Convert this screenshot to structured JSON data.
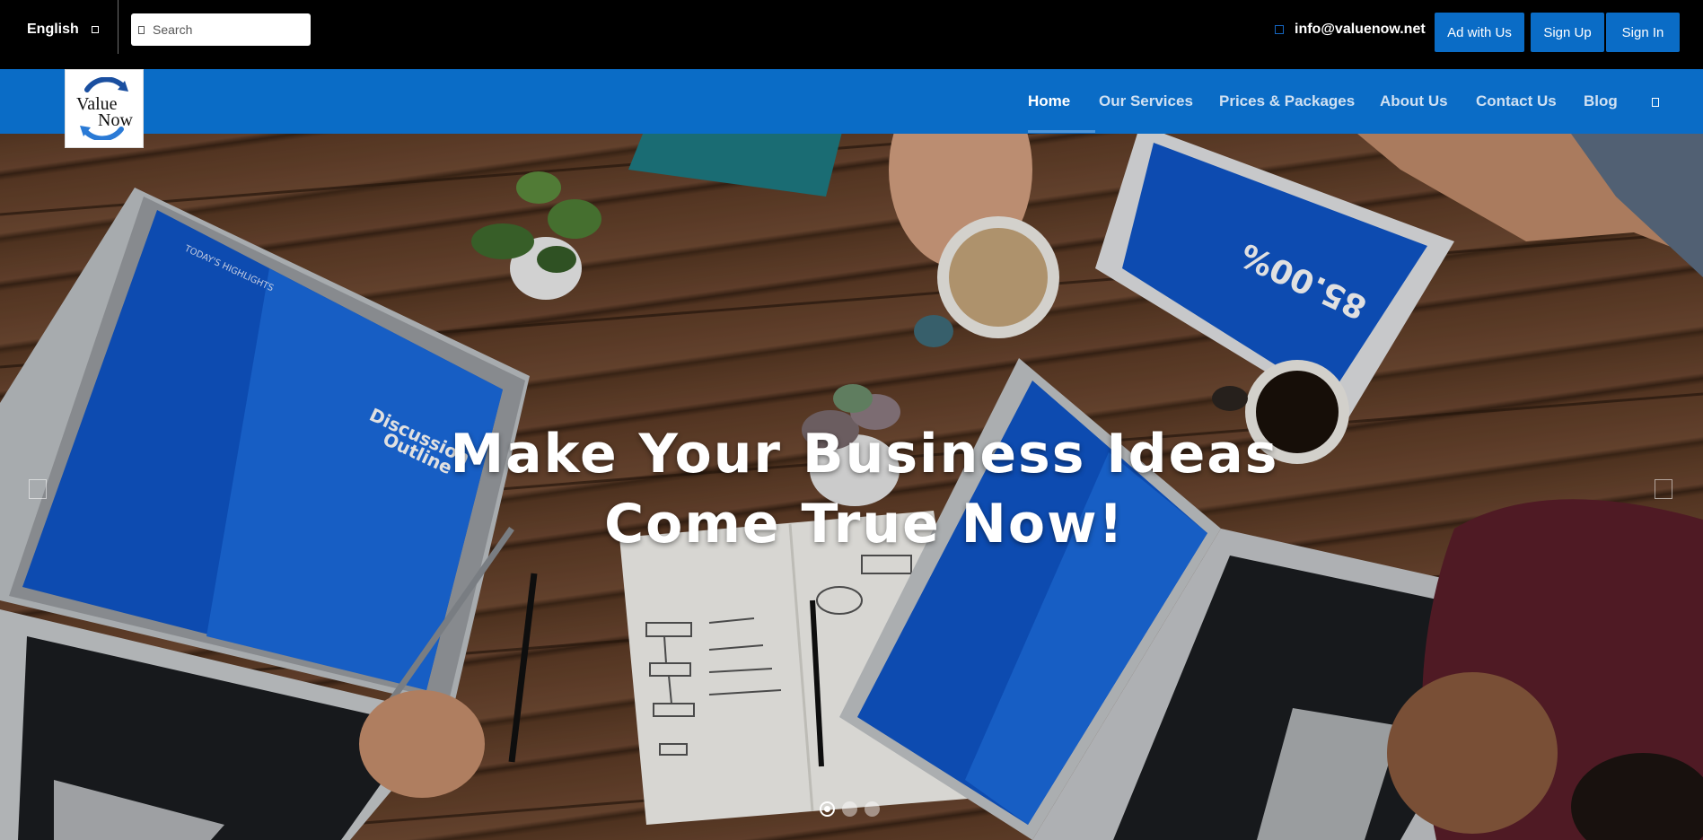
{
  "topbar": {
    "language": "English",
    "search_placeholder": "Search",
    "email": "info@valuenow.net",
    "ad_button": "Ad with Us",
    "signup_button": "Sign Up",
    "signin_button": "Sign In"
  },
  "logo": {
    "line1": "Value",
    "line2": "Now"
  },
  "nav": {
    "items": [
      {
        "label": "Home",
        "active": true
      },
      {
        "label": "Our Services"
      },
      {
        "label": "Prices & Packages"
      },
      {
        "label": "About Us"
      },
      {
        "label": "Contact Us"
      },
      {
        "label": "Blog"
      }
    ]
  },
  "hero": {
    "headline_line1": "Make Your Business Ideas",
    "headline_line2": "Come True Now!",
    "slide_count": 3,
    "active_slide": 1,
    "laptop_left_screen": {
      "heading": "TODAY'S HIGHLIGHTS",
      "title_line1": "Discussion",
      "title_line2": "Outline"
    },
    "tablet_screen": {
      "value": "85.00%"
    }
  },
  "colors": {
    "brand_blue": "#0a6cc6",
    "topbar_bg": "#000000",
    "screen_blue": "#1565d8"
  }
}
